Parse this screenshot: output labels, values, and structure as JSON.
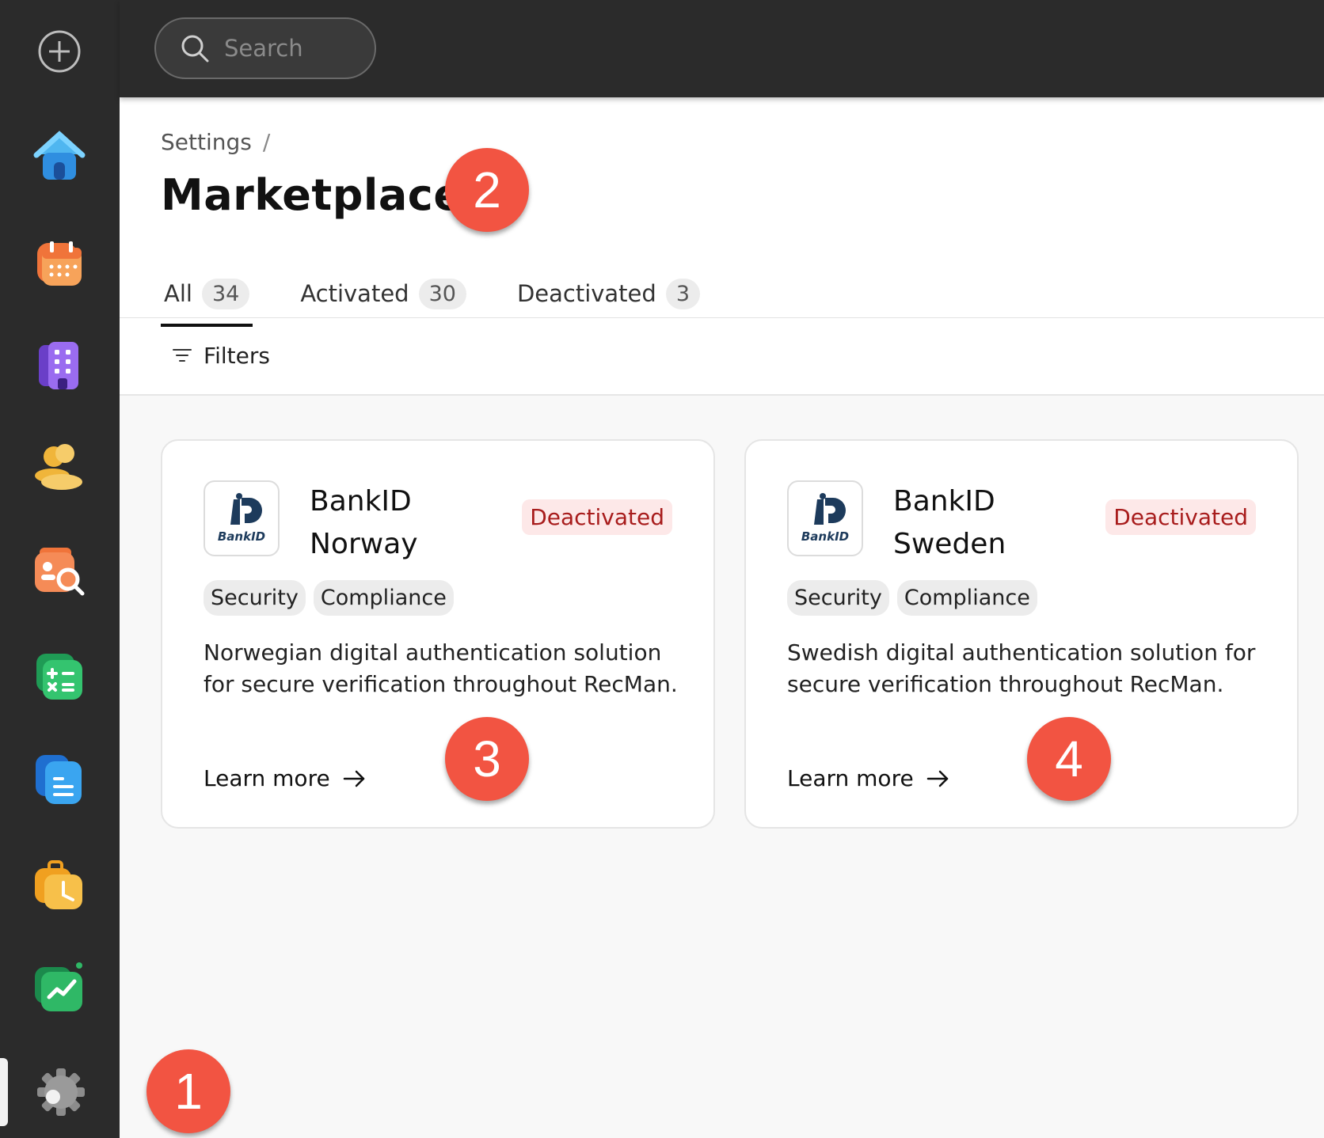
{
  "search": {
    "placeholder": "Search"
  },
  "sidebar": {
    "items": [
      {
        "name": "add",
        "icon": "plus-circle-icon"
      },
      {
        "name": "home",
        "icon": "home-icon"
      },
      {
        "name": "calendar",
        "icon": "calendar-icon"
      },
      {
        "name": "companies",
        "icon": "building-icon"
      },
      {
        "name": "people",
        "icon": "people-icon"
      },
      {
        "name": "candidate-search",
        "icon": "person-search-icon"
      },
      {
        "name": "calculator",
        "icon": "calculator-icon"
      },
      {
        "name": "documents",
        "icon": "document-icon"
      },
      {
        "name": "jobs",
        "icon": "briefcase-clock-icon"
      },
      {
        "name": "reports",
        "icon": "chart-icon"
      },
      {
        "name": "settings",
        "icon": "gear-icon"
      }
    ]
  },
  "breadcrumb": {
    "parent": "Settings",
    "separator": "/"
  },
  "page": {
    "title": "Marketplace"
  },
  "tabs": [
    {
      "label": "All",
      "count": "34"
    },
    {
      "label": "Activated",
      "count": "30"
    },
    {
      "label": "Deactivated",
      "count": "3"
    }
  ],
  "filters": {
    "label": "Filters"
  },
  "cards": [
    {
      "logo_text": "BankID",
      "title_line1": "BankID",
      "title_line2": "Norway",
      "status": "Deactivated",
      "tags": [
        "Security",
        "Compliance"
      ],
      "description": "Norwegian digital authentication solution for secure verification throughout RecMan.",
      "link": "Learn more"
    },
    {
      "logo_text": "BankID",
      "title_line1": "BankID",
      "title_line2": "Sweden",
      "status": "Deactivated",
      "tags": [
        "Security",
        "Compliance"
      ],
      "description": "Swedish digital authentication solution for secure verification throughout RecMan.",
      "link": "Learn more"
    }
  ],
  "markers": [
    "1",
    "2",
    "3",
    "4"
  ],
  "colors": {
    "accent": "#f25442",
    "sidebar": "#2b2b2b",
    "badge_bg": "#fde8e8",
    "badge_text": "#a81c1c"
  }
}
